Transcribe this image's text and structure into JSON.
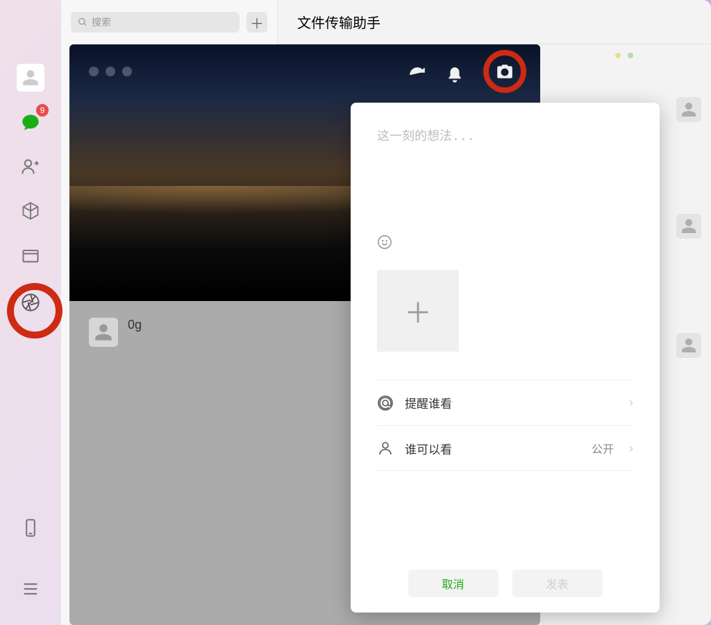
{
  "sidebar": {
    "chat_badge": "9"
  },
  "search": {
    "placeholder": "搜索"
  },
  "header": {
    "title": "文件传输助手"
  },
  "feed": {
    "item_name": "0g"
  },
  "compose": {
    "placeholder": "这一刻的想法...",
    "mention_label": "提醒谁看",
    "visibility_label": "谁可以看",
    "visibility_value": "公开",
    "cancel": "取消",
    "post": "发表"
  }
}
